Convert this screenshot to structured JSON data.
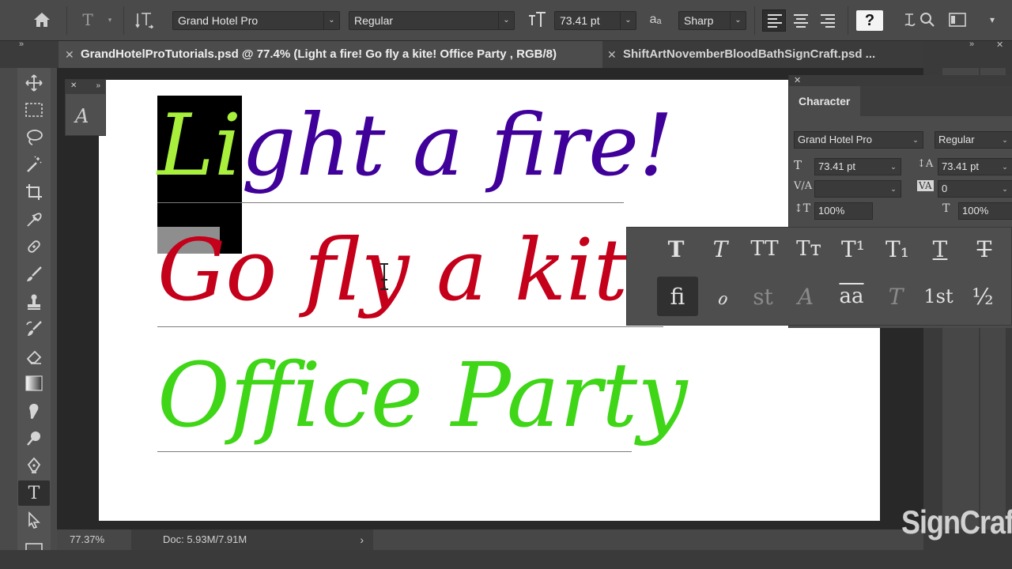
{
  "options_bar": {
    "font_family": "Grand Hotel Pro",
    "font_style": "Regular",
    "font_size": "73.41 pt",
    "aa_icon": "aₐ",
    "antialias": "Sharp",
    "help": "?"
  },
  "tabs": [
    {
      "label": "GrandHotelProTutorials.psd @ 77.4% (Light a fire! Go fly a kite!  Office Party  , RGB/8)",
      "active": true
    },
    {
      "label": "ShiftArtNovemberBloodBathSignCraft.psd ...",
      "active": false
    }
  ],
  "canvas": {
    "lines": [
      {
        "text": "Light a fire!",
        "color": "#40009a"
      },
      {
        "text": "Go fly a kite!",
        "color": "#c4001a"
      },
      {
        "text": "Office Party",
        "color": "#3fd617"
      }
    ],
    "selected_text": "Li",
    "selected_color": "#a8f03c"
  },
  "character_panel": {
    "title": "Character",
    "font_family": "Grand Hotel Pro",
    "font_style": "Regular",
    "font_size": "73.41 pt",
    "leading": "73.41 pt",
    "kerning": "",
    "tracking": "0",
    "vertical_scale": "100%",
    "horizontal_scale": "100%"
  },
  "flyout": {
    "row1": [
      "T",
      "T",
      "TT",
      "Tт",
      "T¹",
      "T₁",
      "T",
      "T"
    ],
    "row2": [
      "ﬁ",
      "ℴ",
      "st",
      "A",
      "aa",
      "T",
      "1st",
      "½"
    ]
  },
  "status": {
    "zoom": "77.37%",
    "doc": "Doc: 5.93M/7.91M"
  },
  "watermark": "SignCraft"
}
